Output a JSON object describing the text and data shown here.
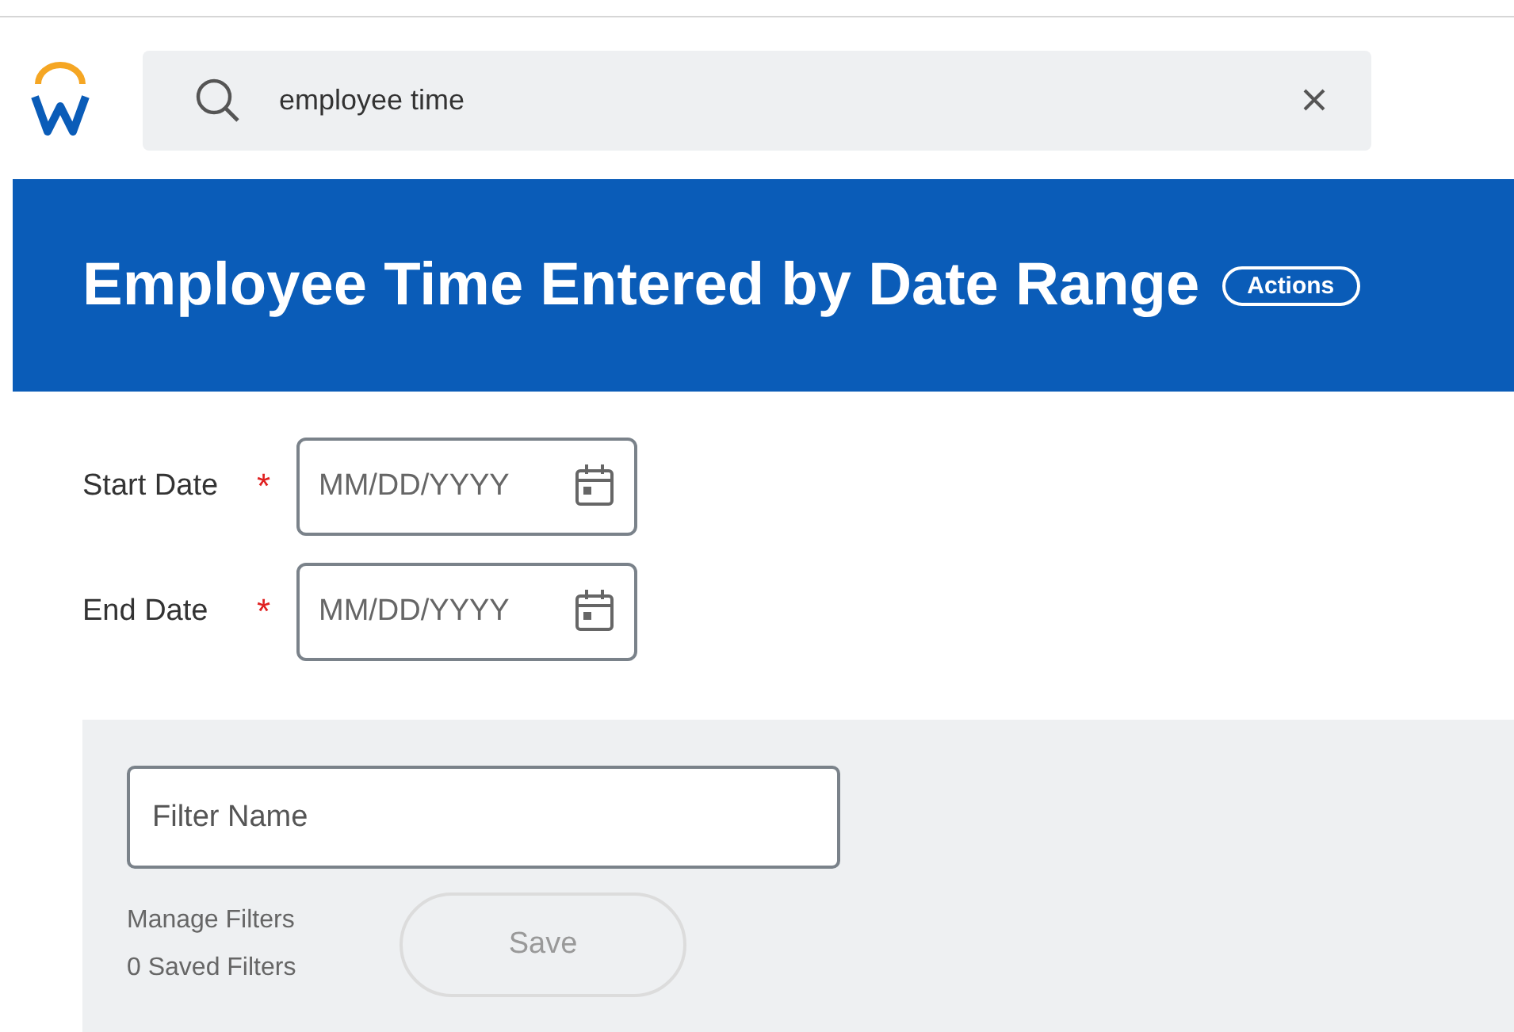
{
  "search": {
    "value": "employee time"
  },
  "header": {
    "title": "Employee Time Entered by Date Range",
    "actions_button": "Actions"
  },
  "fields": [
    {
      "label": "Start Date",
      "required_mark": "*",
      "placeholder": "MM/DD/YYYY"
    },
    {
      "label": "End Date",
      "required_mark": "*",
      "placeholder": "MM/DD/YYYY"
    }
  ],
  "filters": {
    "name_placeholder": "Filter Name",
    "manage_link": "Manage Filters",
    "saved_count": "0 Saved Filters",
    "save_button": {
      "label": "Save",
      "disabled": true
    }
  }
}
